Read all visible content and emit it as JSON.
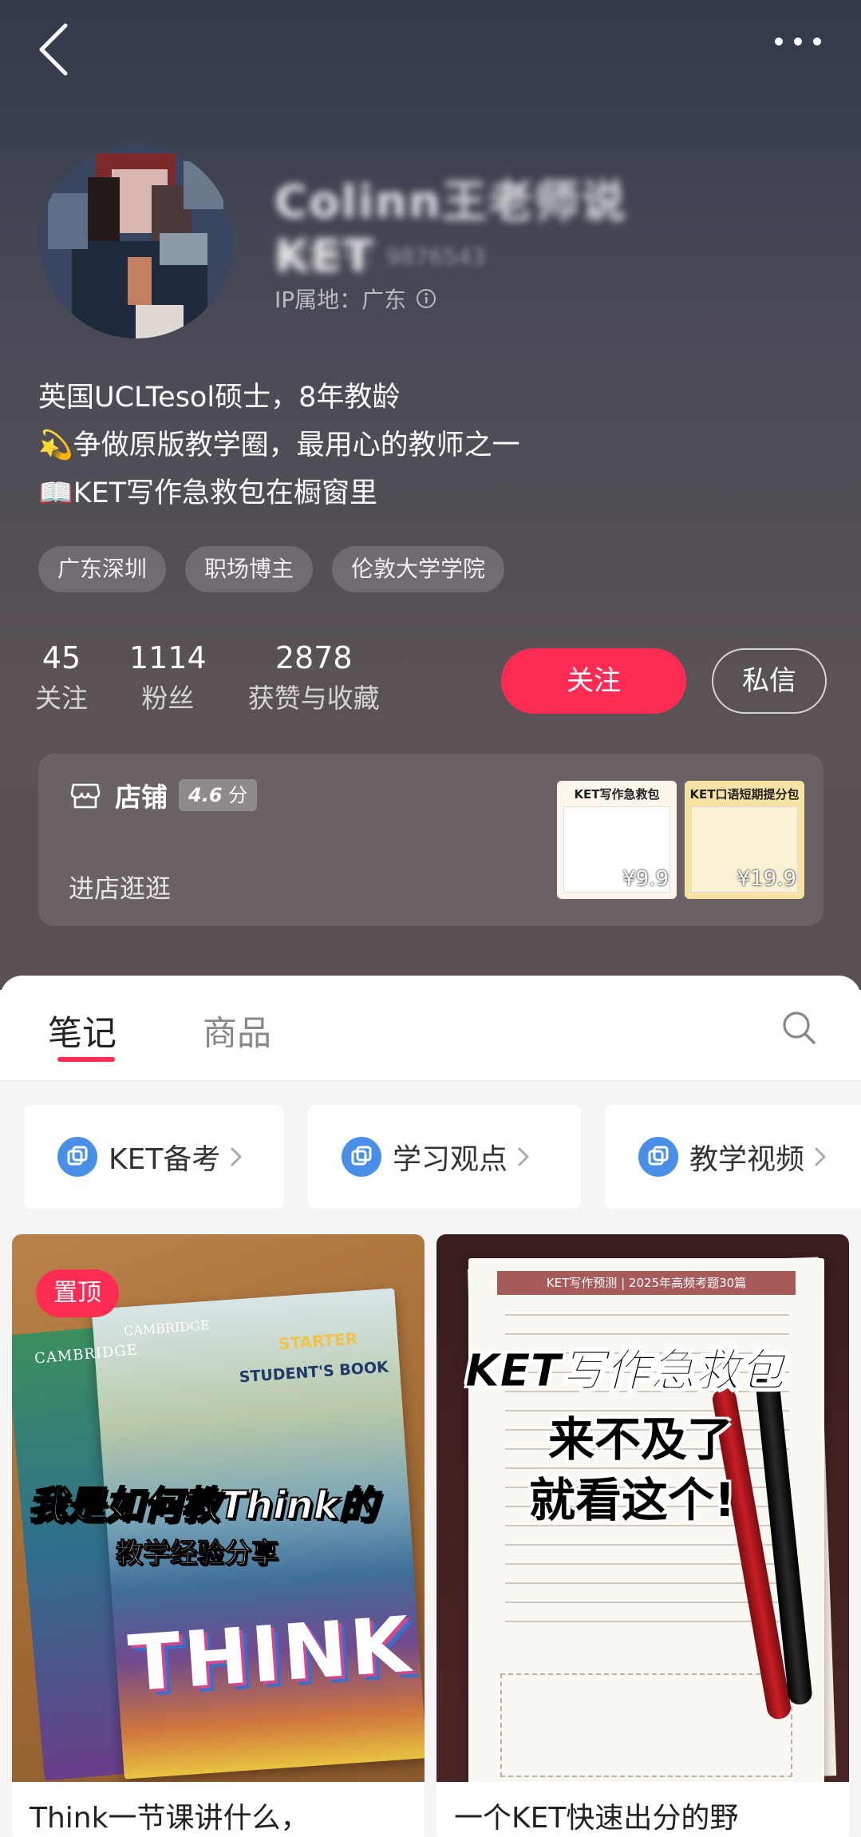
{
  "nav": {
    "back_icon": "chevron-left-icon",
    "more_icon": "ellipsis-icon"
  },
  "profile": {
    "username": "Colinn王老师说KET",
    "user_id": "小红书号：9876543",
    "ip_location": "IP属地：广东",
    "bio": [
      "英国UCLTesol硕士，8年教龄",
      "💫争做原版教学圈，最用心的教师之一",
      "📖KET写作急救包在橱窗里"
    ],
    "tags": [
      "广东深圳",
      "职场博主",
      "伦敦大学学院"
    ]
  },
  "stats": [
    {
      "value": "45",
      "label": "关注"
    },
    {
      "value": "1114",
      "label": "粉丝"
    },
    {
      "value": "2878",
      "label": "获赞与收藏"
    }
  ],
  "actions": {
    "follow": "关注",
    "message": "私信"
  },
  "shop": {
    "name": "店铺",
    "rating_value": "4.6",
    "rating_unit": "分",
    "enter_label": "进店逛逛",
    "products": [
      {
        "title": "KET写作急救包",
        "price": "¥9.9"
      },
      {
        "title": "KET口语短期提分包",
        "price": "¥19.9"
      }
    ]
  },
  "tabs": {
    "notes": "笔记",
    "products": "商品"
  },
  "collections": [
    {
      "label": "KET备考"
    },
    {
      "label": "学习观点"
    },
    {
      "label": "教学视频"
    }
  ],
  "notes": [
    {
      "pinned": "置顶",
      "cover_title": "我是如何教Think的",
      "cover_subtitle": "教学经验分享",
      "book_brand": "CAMBRIDGE",
      "book_starter": "STARTER",
      "book_edition": "STUDENT'S BOOK",
      "book_word": "THINK",
      "title": "Think一节课讲什么，"
    },
    {
      "paper_header": "KET写作预测 | 2025年高频考题30篇",
      "cover_line1": "KET写作急救包",
      "cover_line2": "来不及了",
      "cover_line3": "就看这个!",
      "title": "一个KET快速出分的野"
    }
  ],
  "colors": {
    "accent": "#fe2c55",
    "header_top": "#323a4b",
    "header_bottom": "#5b5053"
  }
}
